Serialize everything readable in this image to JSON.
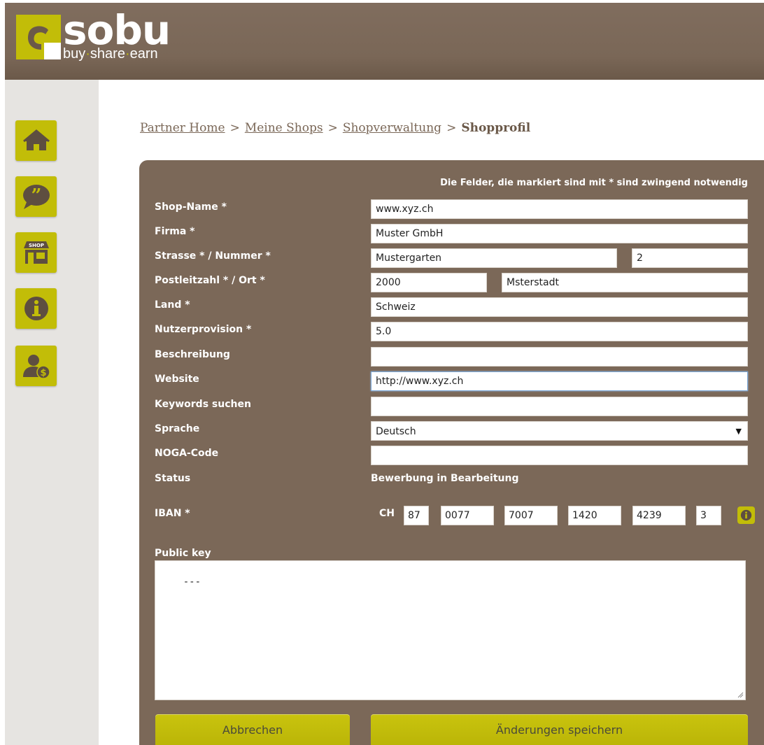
{
  "header": {
    "brand": "sobu",
    "tagline": [
      "buy",
      "share",
      "earn"
    ],
    "colors": {
      "header_bg": "#7a6757",
      "accent": "#c2bd08"
    }
  },
  "sidebar": {
    "items": [
      {
        "icon": "home-icon"
      },
      {
        "icon": "quote-bubble-icon"
      },
      {
        "icon": "shop-icon",
        "badge": "SHOP"
      },
      {
        "icon": "info-icon"
      },
      {
        "icon": "user-money-icon"
      }
    ]
  },
  "breadcrumb": {
    "items": [
      "Partner Home",
      "Meine Shops",
      "Shopverwaltung"
    ],
    "current": "Shopprofil",
    "separator": ">"
  },
  "form": {
    "required_note": "Die Felder, die markiert sind mit * sind zwingend notwendig",
    "labels": {
      "shop_name": "Shop-Name *",
      "firma": "Firma *",
      "strasse": "Strasse * / Nummer *",
      "plz_ort": "Postleitzahl * / Ort *",
      "land": "Land *",
      "nutzerprovision": "Nutzerprovision *",
      "beschreibung": "Beschreibung",
      "website": "Website",
      "keywords": "Keywords suchen",
      "sprache": "Sprache",
      "noga": "NOGA-Code",
      "status": "Status",
      "iban": "IBAN *",
      "public_key": "Public key"
    },
    "values": {
      "shop_name": "www.xyz.ch",
      "firma": "Muster GmbH",
      "strasse": "Mustergarten",
      "nummer": "2",
      "plz": "2000",
      "ort": "Msterstadt",
      "land": "Schweiz",
      "nutzerprovision": "5.0",
      "beschreibung": "",
      "website": "http://www.xyz.ch",
      "keywords": "",
      "sprache": "Deutsch",
      "noga": "",
      "status": "Bewerbung in Bearbeitung",
      "public_key": "---"
    },
    "iban": {
      "country": "CH",
      "parts": [
        "87",
        "0077",
        "7007",
        "1420",
        "4239",
        "3"
      ]
    },
    "buttons": {
      "cancel": "Abbrechen",
      "save": "Änderungen speichern"
    }
  }
}
